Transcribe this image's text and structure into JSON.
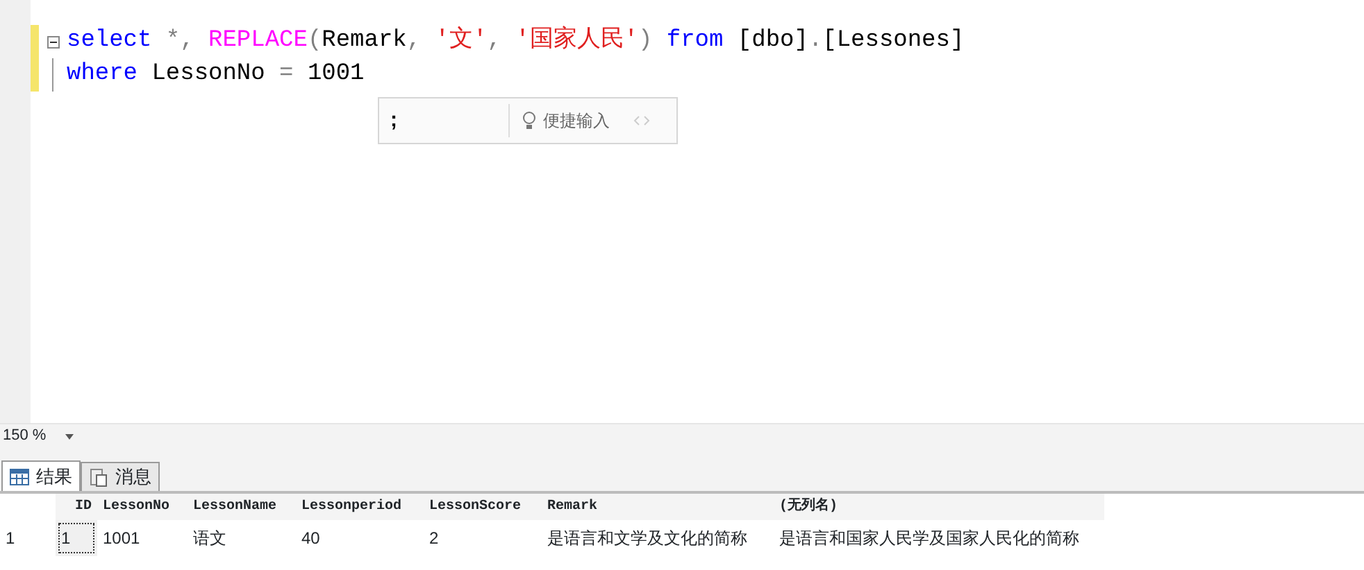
{
  "editor": {
    "lines": [
      {
        "collapsible": true,
        "modified": true,
        "tokens": [
          {
            "kind": "keyword",
            "text": "select"
          },
          {
            "kind": "operator",
            "text": " *, "
          },
          {
            "kind": "function",
            "text": "REPLACE"
          },
          {
            "kind": "operator",
            "text": "("
          },
          {
            "kind": "plain",
            "text": "Remark"
          },
          {
            "kind": "operator",
            "text": ", "
          },
          {
            "kind": "string",
            "text": "'文'"
          },
          {
            "kind": "operator",
            "text": ", "
          },
          {
            "kind": "string",
            "text": "'国家人民'"
          },
          {
            "kind": "operator",
            "text": ") "
          },
          {
            "kind": "keyword",
            "text": "from"
          },
          {
            "kind": "plain",
            "text": " [dbo]"
          },
          {
            "kind": "operator",
            "text": "."
          },
          {
            "kind": "plain",
            "text": "[Lessones]"
          }
        ]
      },
      {
        "collapsible": false,
        "modified": true,
        "tokens": [
          {
            "kind": "keyword",
            "text": "where"
          },
          {
            "kind": "plain",
            "text": " LessonNo "
          },
          {
            "kind": "operator",
            "text": "="
          },
          {
            "kind": "plain",
            "text": " 1001"
          }
        ]
      }
    ],
    "ime_popup": {
      "input": ";",
      "hint": "便捷输入"
    }
  },
  "zoom": {
    "value": "150 %"
  },
  "tabs": [
    {
      "label": "结果",
      "selected": true
    },
    {
      "label": "消息",
      "selected": false
    }
  ],
  "grid": {
    "columns": [
      "ID",
      "LessonNo",
      "LessonName",
      "Lessonperiod",
      "LessonScore",
      "Remark",
      "(无列名)"
    ],
    "rows": [
      {
        "number": "1",
        "cells": [
          {
            "text": "1",
            "selected": true
          },
          {
            "text": "1001",
            "selected": false
          },
          {
            "text": "语文",
            "selected": false
          },
          {
            "text": "40",
            "selected": false
          },
          {
            "text": "2",
            "selected": false
          },
          {
            "text": "是语言和文学及文化的简称",
            "selected": false
          },
          {
            "text": "是语言和国家人民学及国家人民化的简称",
            "selected": false
          }
        ]
      }
    ]
  }
}
